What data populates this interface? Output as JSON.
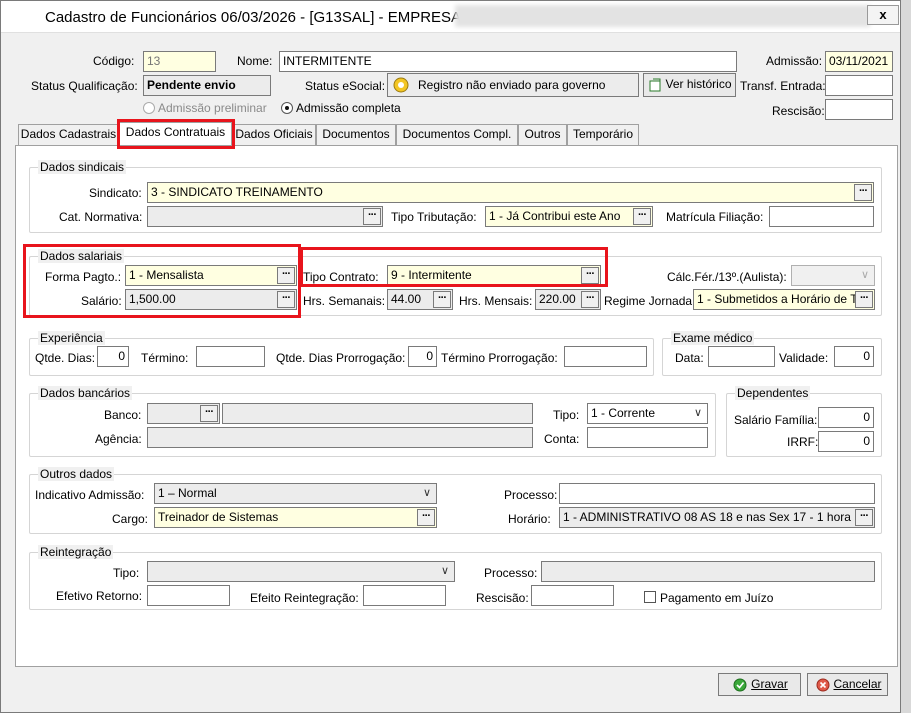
{
  "window": {
    "title": "Cadastro de Funcionários  06/03/2026 - [G13SAL] - EMPRESA",
    "close": "x"
  },
  "header": {
    "codigo_label": "Código:",
    "codigo": "13",
    "nome_label": "Nome:",
    "nome": "INTERMITENTE",
    "admissao_label": "Admissão:",
    "admissao": "03/11/2021",
    "status_qualif_label": "Status Qualificação:",
    "status_qualif": "Pendente envio",
    "status_esocial_label": "Status eSocial:",
    "status_esocial": "Registro não enviado para governo",
    "ver_historico": "Ver histórico",
    "transf_label": "Transf. Entrada:",
    "transf": "",
    "rescisao_label": "Rescisão:",
    "rescisao": "",
    "radio_preliminar": "Admissão preliminar",
    "radio_completa": "Admissão completa"
  },
  "tabs": [
    {
      "label": "Dados Cadastrais"
    },
    {
      "label": "Dados Contratuais"
    },
    {
      "label": "Dados Oficiais"
    },
    {
      "label": "Documentos"
    },
    {
      "label": "Documentos Compl."
    },
    {
      "label": "Outros"
    },
    {
      "label": "Temporário"
    }
  ],
  "sindicais": {
    "title": "Dados sindicais",
    "sindicato_label": "Sindicato:",
    "sindicato": "3 - SINDICATO TREINAMENTO",
    "cat_label": "Cat. Normativa:",
    "cat": "",
    "tipo_trib_label": "Tipo Tributação:",
    "tipo_trib": "1 - Já Contribui este Ano",
    "matricula_label": "Matrícula Filiação:",
    "matricula": ""
  },
  "salariais": {
    "title": "Dados salariais",
    "forma_label": "Forma Pagto.:",
    "forma": "1 -  Mensalista",
    "salario_label": "Salário:",
    "salario": "1,500.00",
    "tipo_contrato_label": "Tipo Contrato:",
    "tipo_contrato": "9 - Intermitente",
    "hrs_sem_label": "Hrs. Semanais:",
    "hrs_sem": "44.00",
    "hrs_mes_label": "Hrs. Mensais:",
    "hrs_mes": "220.00",
    "regime_label": "Regime Jornada:",
    "regime": "1 - Submetidos a Horário de T",
    "calc_label": "Cálc.Fér./13º.(Aulista):",
    "calc": ""
  },
  "experiencia": {
    "title": "Experiência",
    "qtde_label": "Qtde. Dias:",
    "qtde": "0",
    "termino_label": "Término:",
    "termino": "",
    "qtde_prorr_label": "Qtde. Dias Prorrogação:",
    "qtde_prorr": "0",
    "termino_prorr_label": "Término Prorrogação:",
    "termino_prorr": ""
  },
  "exame": {
    "title": "Exame médico",
    "data_label": "Data:",
    "data": "",
    "validade_label": "Validade:",
    "validade": "0"
  },
  "bancarios": {
    "title": "Dados bancários",
    "banco_label": "Banco:",
    "banco": "",
    "banco_nome": "",
    "agencia_label": "Agência:",
    "agencia": "",
    "tipo_label": "Tipo:",
    "tipo": "1 - Corrente",
    "conta_label": "Conta:",
    "conta": ""
  },
  "dependentes": {
    "title": "Dependentes",
    "sal_fam_label": "Salário Família:",
    "sal_fam": "0",
    "irrf_label": "IRRF:",
    "irrf": "0"
  },
  "outros": {
    "title": "Outros dados",
    "indicativo_label": "Indicativo Admissão:",
    "indicativo": "1 – Normal",
    "processo_label": "Processo:",
    "processo": "",
    "cargo_label": "Cargo:",
    "cargo": "Treinador de Sistemas",
    "horario_label": "Horário:",
    "horario": "1 - ADMINISTRATIVO 08 AS 18 e nas Sex 17 - 1 hora"
  },
  "reintegracao": {
    "title": "Reintegração",
    "tipo_label": "Tipo:",
    "tipo": "",
    "processo_label": "Processo:",
    "processo": "",
    "efetivo_label": "Efetivo Retorno:",
    "efetivo": "",
    "efeito_label": "Efeito Reintegração:",
    "efeito": "",
    "rescisao_label": "Rescisão:",
    "rescisao": "",
    "pagamento_label": "Pagamento em Juízo"
  },
  "buttons": {
    "gravar": "Gravar",
    "cancelar": "Cancelar"
  },
  "ellipsis": "···",
  "arrow": "∨"
}
